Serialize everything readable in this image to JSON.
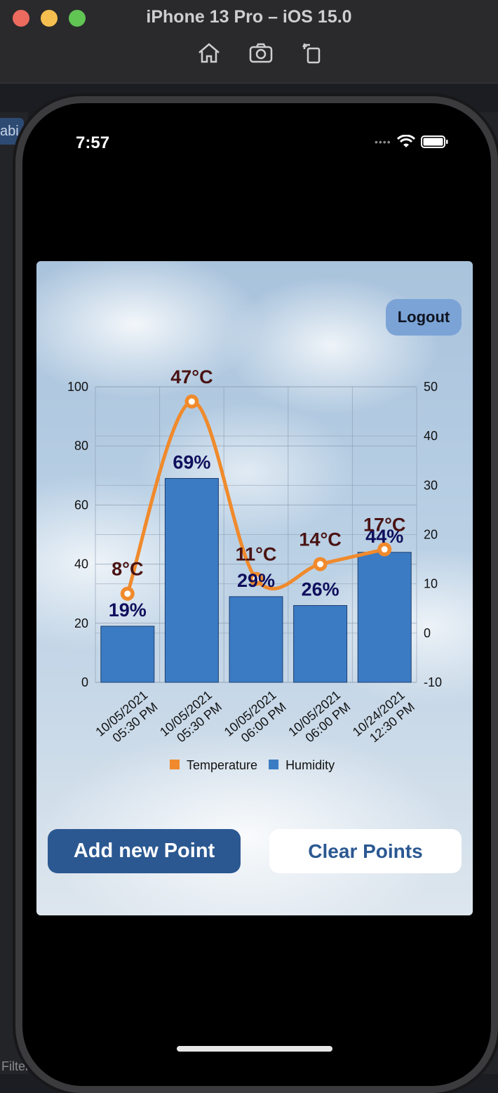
{
  "simulator": {
    "title": "iPhone 13 Pro – iOS 15.0",
    "tools": [
      "home-icon",
      "screenshot-icon",
      "rotate-icon"
    ]
  },
  "ide": {
    "tab_label": "abi",
    "filter_label": "Filter"
  },
  "status_bar": {
    "time": "7:57"
  },
  "app": {
    "logout_label": "Logout",
    "add_button_label": "Add new Point",
    "clear_button_label": "Clear Points"
  },
  "colors": {
    "bar": "#3b7bc4",
    "line": "#f08a2c",
    "temp_label": "#4a1313",
    "humidity_label": "#0f0f5c",
    "primary_button": "#2b5891"
  },
  "chart_data": {
    "type": "bar",
    "categories": [
      "10/05/2021\n05:30 PM",
      "10/05/2021\n05:30 PM",
      "10/05/2021\n06:00 PM",
      "10/05/2021\n06:00 PM",
      "10/24/2021\n12:30 PM"
    ],
    "series": [
      {
        "name": "Humidity",
        "type": "bar",
        "axis": "left",
        "values": [
          19,
          69,
          29,
          26,
          44
        ],
        "labels": [
          "19%",
          "69%",
          "29%",
          "26%",
          "44%"
        ]
      },
      {
        "name": "Temperature",
        "type": "line",
        "axis": "right",
        "values": [
          8,
          47,
          11,
          14,
          17
        ],
        "labels": [
          "8°C",
          "47°C",
          "11°C",
          "14°C",
          "17°C"
        ]
      }
    ],
    "left_axis": {
      "min": 0,
      "max": 100,
      "ticks": [
        0,
        20,
        40,
        60,
        80,
        100
      ]
    },
    "right_axis": {
      "min": -10,
      "max": 50,
      "ticks": [
        -10,
        0,
        10,
        20,
        30,
        40,
        50
      ]
    },
    "grid": true,
    "legend": "bottom-center"
  }
}
